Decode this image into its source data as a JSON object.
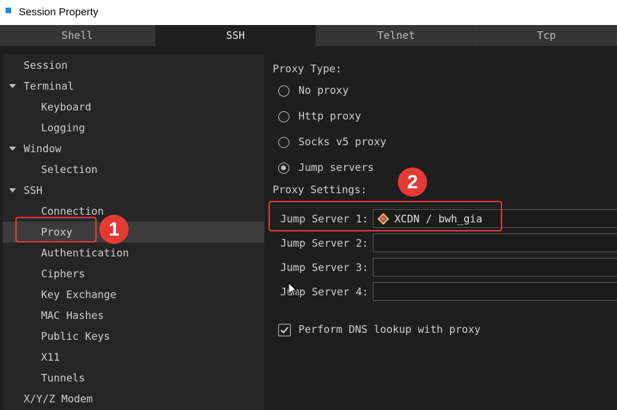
{
  "window": {
    "title": "Session Property"
  },
  "tabs": [
    {
      "label": "Shell",
      "active": false
    },
    {
      "label": "SSH",
      "active": true
    },
    {
      "label": "Telnet",
      "active": false
    },
    {
      "label": "Tcp",
      "active": false
    }
  ],
  "tree": [
    {
      "label": "Session",
      "level": 0,
      "expandable": false
    },
    {
      "label": "Terminal",
      "level": 0,
      "expandable": true
    },
    {
      "label": "Keyboard",
      "level": 1
    },
    {
      "label": "Logging",
      "level": 1
    },
    {
      "label": "Window",
      "level": 0,
      "expandable": true
    },
    {
      "label": "Selection",
      "level": 1
    },
    {
      "label": "SSH",
      "level": 0,
      "expandable": true
    },
    {
      "label": "Connection",
      "level": 1
    },
    {
      "label": "Proxy",
      "level": 1,
      "selected": true
    },
    {
      "label": "Authentication",
      "level": 1
    },
    {
      "label": "Ciphers",
      "level": 1
    },
    {
      "label": "Key Exchange",
      "level": 1
    },
    {
      "label": "MAC Hashes",
      "level": 1
    },
    {
      "label": "Public Keys",
      "level": 1
    },
    {
      "label": "X11",
      "level": 1
    },
    {
      "label": "Tunnels",
      "level": 1
    },
    {
      "label": "X/Y/Z Modem",
      "level": 0,
      "expandable": false
    }
  ],
  "proxy": {
    "type_label": "Proxy Type:",
    "options": [
      {
        "label": "No proxy",
        "checked": false
      },
      {
        "label": "Http proxy",
        "checked": false
      },
      {
        "label": "Socks v5 proxy",
        "checked": false
      },
      {
        "label": "Jump servers",
        "checked": true
      }
    ],
    "settings_label": "Proxy Settings:",
    "jump_servers": [
      {
        "label": "Jump Server 1:",
        "value": "XCDN / bwh_gia",
        "icon": "server-icon"
      },
      {
        "label": "Jump Server 2:",
        "value": ""
      },
      {
        "label": "Jump Server 3:",
        "value": ""
      },
      {
        "label": "Jump Server 4:",
        "value": ""
      }
    ],
    "dns_label": "Perform DNS lookup with proxy",
    "dns_checked": true
  },
  "annotations": {
    "marker1": "1",
    "marker2": "2"
  },
  "colors": {
    "highlight": "#e53935",
    "accent": "#1e88e5"
  }
}
